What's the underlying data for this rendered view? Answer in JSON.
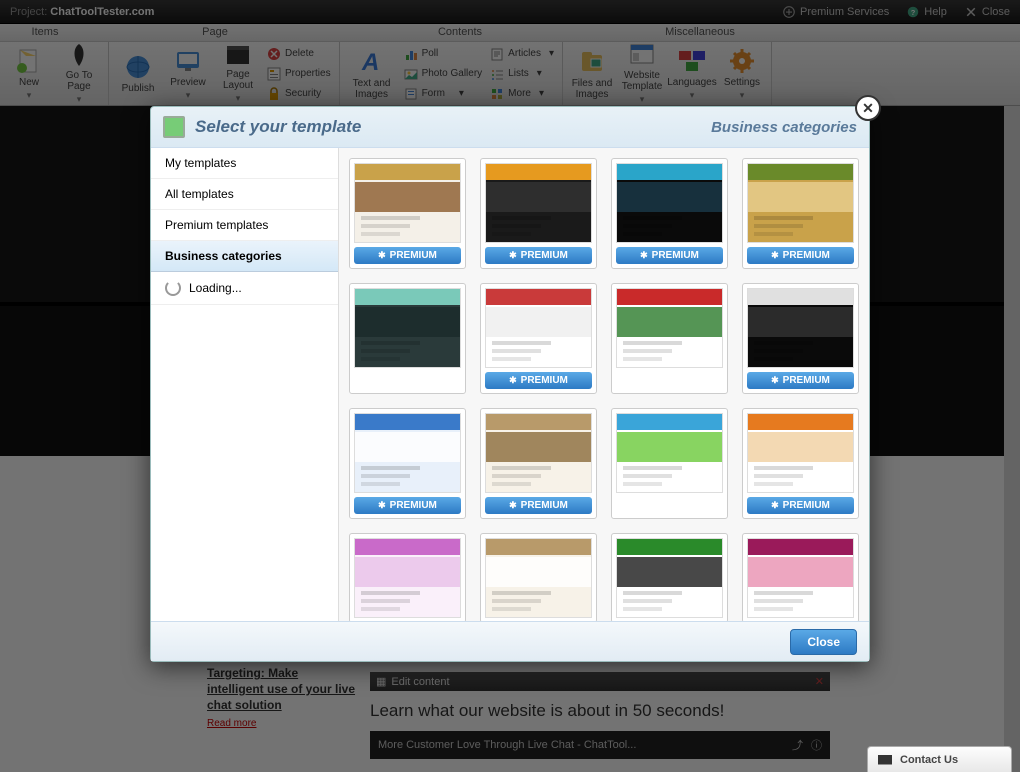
{
  "topbar": {
    "project_label": "Project:",
    "project_name": "ChatToolTester.com",
    "premium": "Premium Services",
    "help": "Help",
    "close": "Close"
  },
  "ribbon_tabs": {
    "items": "Items",
    "page": "Page",
    "contents": "Contents",
    "misc": "Miscellaneous"
  },
  "ribbon": {
    "new": "New",
    "goto": "Go To Page",
    "publish": "Publish",
    "preview": "Preview",
    "layout": "Page Layout",
    "delete": "Delete",
    "properties": "Properties",
    "security": "Security",
    "text": "Text and Images",
    "poll": "Poll",
    "gallery": "Photo Gallery",
    "form": "Form",
    "articles": "Articles",
    "lists": "Lists",
    "more": "More",
    "files": "Files and Images",
    "template": "Website Template",
    "languages": "Languages",
    "settings": "Settings"
  },
  "article": {
    "title": "Targeting: Make intelligent use of your live chat solution",
    "read": "Read more"
  },
  "content_panel": {
    "edit": "Edit content",
    "headline": "Learn what our website is about in 50 seconds!",
    "video_title": "More Customer Love Through Live Chat - ChatTool..."
  },
  "modal": {
    "title": "Select your template",
    "category": "Business categories",
    "close_btn": "Close",
    "sidebar": {
      "my": "My templates",
      "all": "All templates",
      "premium": "Premium templates",
      "business": "Business categories",
      "loading": "Loading..."
    },
    "premium_label": "PREMIUM",
    "templates": [
      {
        "premium": true,
        "c1": "#f4f0e8",
        "c2": "#c9a24a",
        "c3": "#8a5a2a"
      },
      {
        "premium": true,
        "c1": "#1a1a1a",
        "c2": "#e69a1f",
        "c3": "#333333"
      },
      {
        "premium": true,
        "c1": "#0a0a0a",
        "c2": "#2aa5c9",
        "c3": "#1a3a4a"
      },
      {
        "premium": true,
        "c1": "#c9a24a",
        "c2": "#6a8a2a",
        "c3": "#e8d090"
      },
      {
        "premium": false,
        "c1": "#2a3a3a",
        "c2": "#7ac9b9",
        "c3": "#1a2a2a"
      },
      {
        "premium": true,
        "c1": "#ffffff",
        "c2": "#c93a3a",
        "c3": "#eeeeee"
      },
      {
        "premium": false,
        "c1": "#ffffff",
        "c2": "#c92a2a",
        "c3": "#2a7a2a"
      },
      {
        "premium": true,
        "c1": "#0a0a0a",
        "c2": "#e0e0e0",
        "c3": "#333333"
      },
      {
        "premium": true,
        "c1": "#e8f0fa",
        "c2": "#3a7ac9",
        "c3": "#ffffff"
      },
      {
        "premium": true,
        "c1": "#f7f2e8",
        "c2": "#b89a6a",
        "c3": "#8a6a3a"
      },
      {
        "premium": false,
        "c1": "#ffffff",
        "c2": "#3aa5d9",
        "c3": "#6ac93a"
      },
      {
        "premium": true,
        "c1": "#ffffff",
        "c2": "#e67a1f",
        "c3": "#f0d0a0"
      },
      {
        "premium": false,
        "c1": "#faf0fa",
        "c2": "#c96ac9",
        "c3": "#e8c0e8"
      },
      {
        "premium": false,
        "c1": "#f7f2e8",
        "c2": "#b89a6a",
        "c3": "#ffffff"
      },
      {
        "premium": false,
        "c1": "#ffffff",
        "c2": "#2a8a2a",
        "c3": "#1a1a1a"
      },
      {
        "premium": false,
        "c1": "#ffffff",
        "c2": "#9a1a5a",
        "c3": "#e890b0"
      }
    ]
  },
  "contact": "Contact Us"
}
